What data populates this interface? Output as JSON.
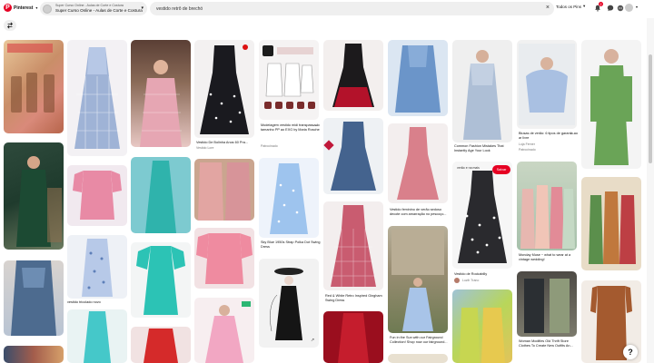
{
  "brand": {
    "name": "Pinterest",
    "color": "#e60023",
    "logo_letter": "P"
  },
  "board": {
    "subtitle": "Super Curso Online - Aulas de Corte e Costura",
    "title": "Super Curso Online - Aulas de Corte e Costura"
  },
  "search": {
    "value": "vestido retrô de brechó",
    "clear_icon": "close-icon"
  },
  "filter": {
    "label": "Todos os Pins"
  },
  "notifications": {
    "count": "2"
  },
  "help": {
    "label": "?"
  },
  "pins": [
    {
      "title": "Vestido De Bolinha Anos 60 Pra...",
      "subtitle": "Vestido Lore"
    },
    {
      "title": "Modelagem vestido midi transpassado tamanho PP ao EXG by Maria Rosche",
      "subtitle": "Maria Rosche",
      "extra": "Patrocinado"
    },
    {
      "title": "Common Fashion Mistakes That Instantly Age Your Look",
      "subtitle": ""
    },
    {
      "title": "Blusas de verão: 6 tipos de garantir ao ar livre",
      "subtitle": "Loja Ferner",
      "extra": "Patrocinado"
    },
    {
      "title": "vestido tricolado novo",
      "subtitle": ""
    },
    {
      "title": "Sky Blue 1950s Strap Polka Dot Swing Dress",
      "subtitle": ""
    },
    {
      "title": "Vestido feminino de verão sedoso decote com amarração no pescoço...",
      "subtitle": ""
    },
    {
      "title": "Vestido de Rockabilly",
      "subtitle": "Luzih Trano"
    },
    {
      "title": "Monday Muse ~ what to wear at a vintage wedding!",
      "subtitle": ""
    },
    {
      "title": "Red & White Retro Inspired Gingham Swing Dress",
      "subtitle": ""
    },
    {
      "title": "Fun in the Sun with our Fairground Collection! Shop now our fairground...",
      "subtitle": ""
    },
    {
      "title": "Woman Modifies Old Thrift Store Clothes To Create New Outfits An...",
      "subtitle": ""
    }
  ],
  "overlay": {
    "save_label": "Salvar",
    "text": "verão e na mais"
  }
}
